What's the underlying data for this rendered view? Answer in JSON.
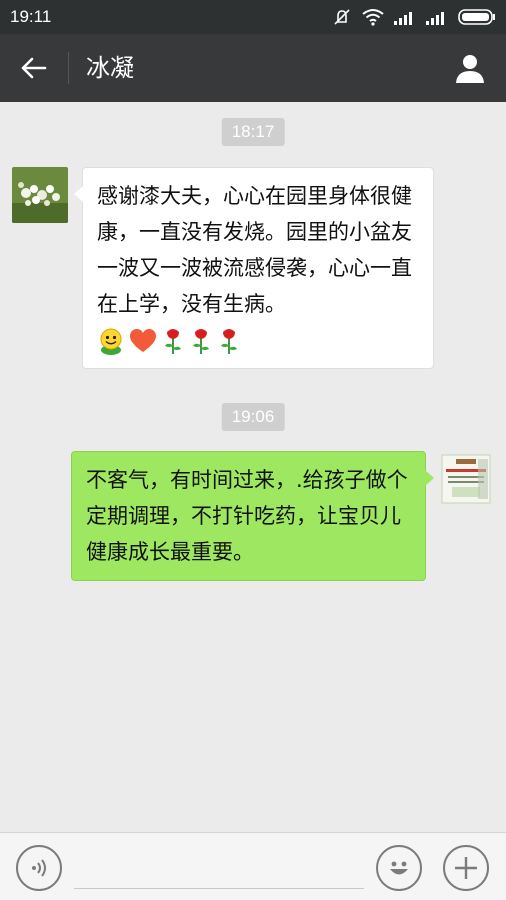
{
  "status_bar": {
    "time": "19:11"
  },
  "header": {
    "title": "冰凝"
  },
  "messages": [
    {
      "timestamp": "18:17",
      "direction": "incoming",
      "text": "感谢漆大夫，心心在园里身体很健康，一直没有发烧。园里的小盆友一波又一波被流感侵袭，心心一直在上学，没有生病。",
      "emoji": [
        "smiley-icon",
        "heart-icon",
        "rose-icon",
        "rose-icon",
        "rose-icon"
      ]
    },
    {
      "timestamp": "19:06",
      "direction": "outgoing",
      "text": "不客气，有时间过来，.给孩子做个定期调理，不打针吃药，让宝贝儿健康成长最重要。"
    }
  ],
  "colors": {
    "status_bar": "#2e3132",
    "nav_bar": "#37393b",
    "outgoing_bubble": "#9ee760",
    "incoming_bubble": "#ffffff",
    "background": "#ebebeb"
  }
}
